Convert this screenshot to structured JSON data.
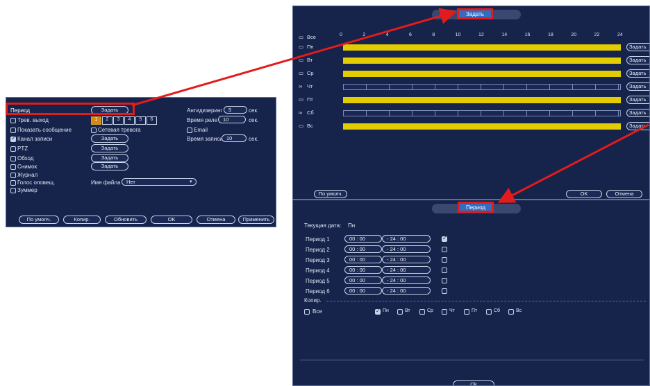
{
  "left_panel": {
    "row_period": "Период",
    "row_period_btn": "Задать",
    "antidither_label": "Антидизеринг",
    "antidither_value": "5",
    "sec1": "сек.",
    "alarm_out_label": "Трев. выход",
    "alarm_channels": [
      "1",
      "2",
      "3",
      "4",
      "5",
      "6"
    ],
    "relay_time_label": "Время реле",
    "relay_time_value": "10",
    "sec2": "сек.",
    "show_message_label": "Показать сообщение",
    "network_alarm_label": "Сетевая тревога",
    "email_label": "Email",
    "record_channel_label": "Канал записи",
    "record_channel_btn": "Задать",
    "record_time_label": "Время записи",
    "record_time_value": "10",
    "sec3": "сек.",
    "ptz_label": "PTZ",
    "ptz_btn": "Задать",
    "tour_label": "Обход",
    "tour_btn": "Задать",
    "snapshot_label": "Снимок",
    "snapshot_btn": "Задать",
    "journal_label": "Журнал",
    "voice_label": "Голос оповещ.",
    "filename_label": "Имя файла",
    "filename_value": "Нет",
    "buzzer_label": "Зуммер",
    "btn_default": "По умолч.",
    "btn_copy": "Копир.",
    "btn_refresh": "Обновить",
    "btn_ok": "OK",
    "btn_cancel": "Отмена",
    "btn_apply": "Применить"
  },
  "schedule_panel": {
    "title": "Задать",
    "all_label": "Все",
    "hour_ticks": [
      "0",
      "2",
      "4",
      "6",
      "8",
      "10",
      "12",
      "14",
      "16",
      "18",
      "20",
      "22",
      "24"
    ],
    "days": [
      {
        "label": "Пн",
        "full": true,
        "btn": "Задать"
      },
      {
        "label": "Вт",
        "full": true,
        "btn": "Задать"
      },
      {
        "label": "Ср",
        "full": true,
        "btn": "Задать"
      },
      {
        "label": "Чт",
        "full": false,
        "btn": "Задать"
      },
      {
        "label": "Пт",
        "full": true,
        "btn": "Задать"
      },
      {
        "label": "Сб",
        "full": false,
        "btn": "Задать"
      },
      {
        "label": "Вс",
        "full": true,
        "btn": "Задать"
      }
    ],
    "btn_default": "По умолч.",
    "btn_ok": "OK",
    "btn_cancel": "Отмена"
  },
  "period_panel": {
    "title": "Период",
    "current_date_label": "Текущая дата:",
    "current_date_value": "Пн",
    "periods": [
      {
        "label": "Период 1",
        "start": "00 : 00",
        "end": "- 24 : 00",
        "checked": true
      },
      {
        "label": "Период 2",
        "start": "00 : 00",
        "end": "- 24 : 00",
        "checked": false
      },
      {
        "label": "Период 3",
        "start": "00 : 00",
        "end": "- 24 : 00",
        "checked": false
      },
      {
        "label": "Период 4",
        "start": "00 : 00",
        "end": "- 24 : 00",
        "checked": false
      },
      {
        "label": "Период 5",
        "start": "00 : 00",
        "end": "- 24 : 00",
        "checked": false
      },
      {
        "label": "Период 6",
        "start": "00 : 00",
        "end": "- 24 : 00",
        "checked": false
      }
    ],
    "copy_label": "Копир.",
    "all_label": "Все",
    "copy_days": [
      {
        "label": "Пн",
        "checked": true
      },
      {
        "label": "Вт",
        "checked": false
      },
      {
        "label": "Ср",
        "checked": false
      },
      {
        "label": "Чт",
        "checked": false
      },
      {
        "label": "Пт",
        "checked": false
      },
      {
        "label": "Сб",
        "checked": false
      },
      {
        "label": "Вс",
        "checked": false
      }
    ],
    "btn_ok": "Ok"
  },
  "colors": {
    "panel_bg": "#16234a",
    "highlight_border": "#e21c1c",
    "bar_fill": "#e3cc00",
    "arrow": "#e21c1c"
  }
}
